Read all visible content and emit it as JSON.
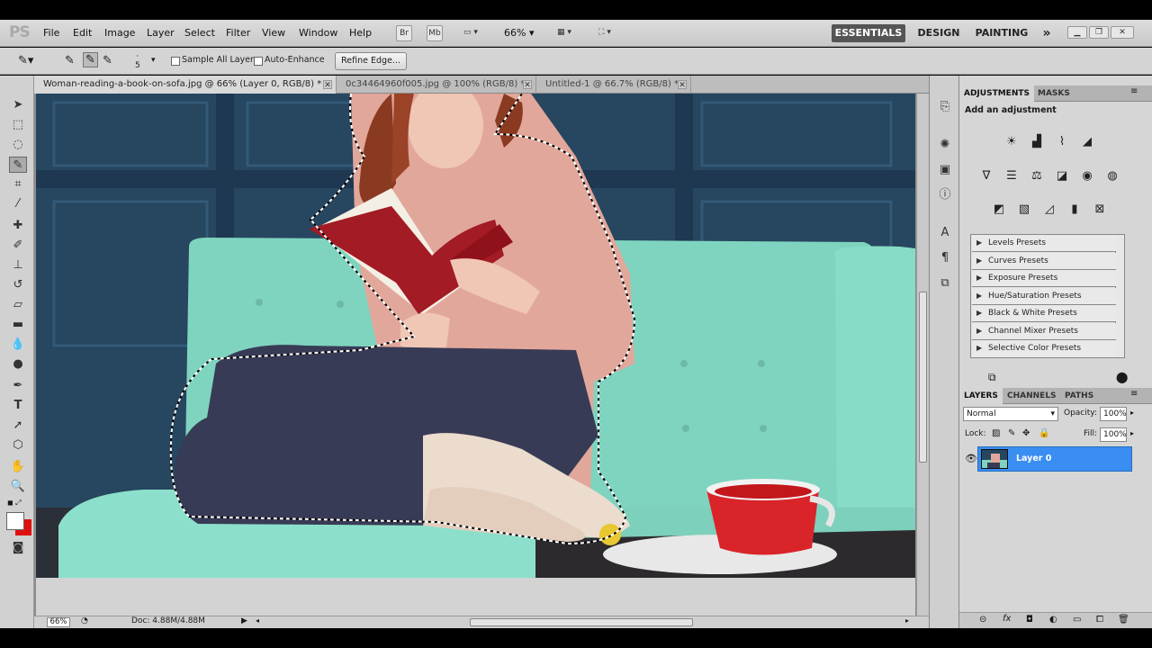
{
  "app": {
    "logo": "PS"
  },
  "menu": [
    "File",
    "Edit",
    "Image",
    "Layer",
    "Select",
    "Filter",
    "View",
    "Window",
    "Help"
  ],
  "appbar": {
    "br_label": "Br",
    "mb_label": "Mb",
    "zoom": "66%"
  },
  "workspaces": [
    "ESSENTIALS",
    "DESIGN",
    "PAINTING",
    "»"
  ],
  "options": {
    "brush_size": "5",
    "sample_all_layers": "Sample All Layers",
    "auto_enhance": "Auto-Enhance",
    "refine_edge": "Refine Edge..."
  },
  "doc_tabs": [
    {
      "title": "Woman-reading-a-book-on-sofa.jpg @ 66% (Layer 0, RGB/8) *",
      "active": true
    },
    {
      "title": "0c34464960f005.jpg @ 100% (RGB/8) *",
      "active": false
    },
    {
      "title": "Untitled-1 @ 66.7% (RGB/8) *",
      "active": false
    }
  ],
  "status": {
    "zoom": "66%",
    "doc": "Doc: 4.88M/4.88M"
  },
  "adjustments": {
    "tabs": [
      "ADJUSTMENTS",
      "MASKS"
    ],
    "heading": "Add an adjustment",
    "presets": [
      "Levels Presets",
      "Curves Presets",
      "Exposure Presets",
      "Hue/Saturation Presets",
      "Black & White Presets",
      "Channel Mixer Presets",
      "Selective Color Presets"
    ]
  },
  "layers": {
    "tabs": [
      "LAYERS",
      "CHANNELS",
      "PATHS"
    ],
    "blend_mode": "Normal",
    "opacity_label": "Opacity:",
    "opacity": "100%",
    "lock_label": "Lock:",
    "fill_label": "Fill:",
    "fill": "100%",
    "items": [
      {
        "name": "Layer 0",
        "selected": true
      }
    ]
  },
  "colors": {
    "accent": "#3a8ef1",
    "foreground": "#ffffff",
    "background": "#e01010"
  }
}
